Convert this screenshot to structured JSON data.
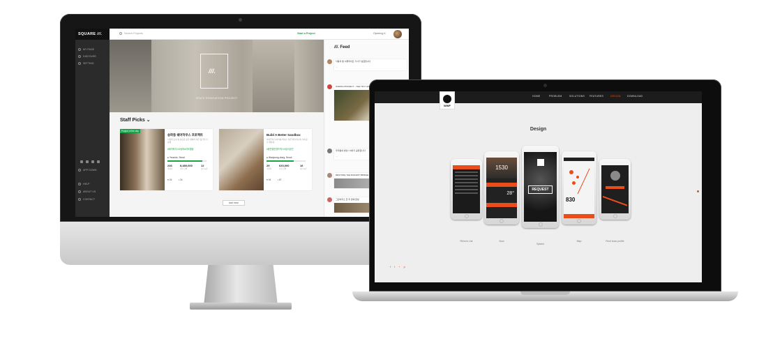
{
  "square": {
    "brand": "SQUARE",
    "nav": [
      "MY PAGE",
      "DISCOVER",
      "SETTING"
    ],
    "bottom_nav": [
      "APP DOWN",
      "HELP",
      "ABOUT US",
      "CONTACT"
    ],
    "search_placeholder": "Search Projects",
    "start_project": "Start a Project",
    "user_name": "Opening K",
    "hero_caption": "SPACE RENOVATION PROJECT",
    "staff_picks": "Staff Picks",
    "cards": [
      {
        "tag": "Project of the day",
        "title": "송파동 쉐어하우스 프로젝트",
        "desc": "서울의 도심 속 새로운 공간 재해석 작은 공간을 더 넓게",
        "tags": "#쉐어하우스#송파#리모델링",
        "location": "Yeouido, Seoul",
        "progress": 0.9,
        "stats": [
          {
            "v": "246",
            "l": "후원자"
          },
          {
            "v": "8,480,000",
            "l": "모인 금액"
          },
          {
            "v": "12",
            "l": "남은시간"
          }
        ],
        "likes": "26",
        "comments": "34"
      },
      {
        "tag": "",
        "title": "Build A Better Sandbox",
        "desc": "아이들의 놀이터를 바꾸는 작은 변화 어린이 놀이공간 재설계",
        "tags": "#동탄열린샌드박스#놀이공간",
        "location": "Wanjoung-dong, Seoul",
        "progress": 0.7,
        "stats": [
          {
            "v": "29",
            "l": "후원자"
          },
          {
            "v": "620,000",
            "l": "모인 금액"
          },
          {
            "v": "16",
            "l": "남은시간"
          }
        ],
        "likes": "94",
        "comments": "87"
      }
    ],
    "load_more": "load more",
    "feed_title": "Feed",
    "feed": [
      "낙동과 벤 서울라이프 기사가 실렸습니다",
      "GWANG-PROJECT - THE TINY HOUSE",
      "우리동네 변신!! 이야기 공유합니다",
      "RESTORE THE RAILWAY BRIDGE",
      "그린하우스 한 주 만에 완성"
    ]
  },
  "wwf": {
    "logo": "WWF",
    "nav": [
      "HOME",
      "PROBLEM",
      "SOLUTIONS",
      "FEATURES",
      "DESIGN",
      "DOWNLOAD"
    ],
    "active_nav": "DESIGN",
    "title": "Design",
    "phones": [
      {
        "caption": "Rhino's List"
      },
      {
        "caption": "Now",
        "number": "1530",
        "temp": "28°"
      },
      {
        "caption": "Splash",
        "button": "REQUEST"
      },
      {
        "caption": "Map",
        "number": "830"
      },
      {
        "caption": "Rent boss profile"
      }
    ],
    "accent": "#e84e1b"
  }
}
